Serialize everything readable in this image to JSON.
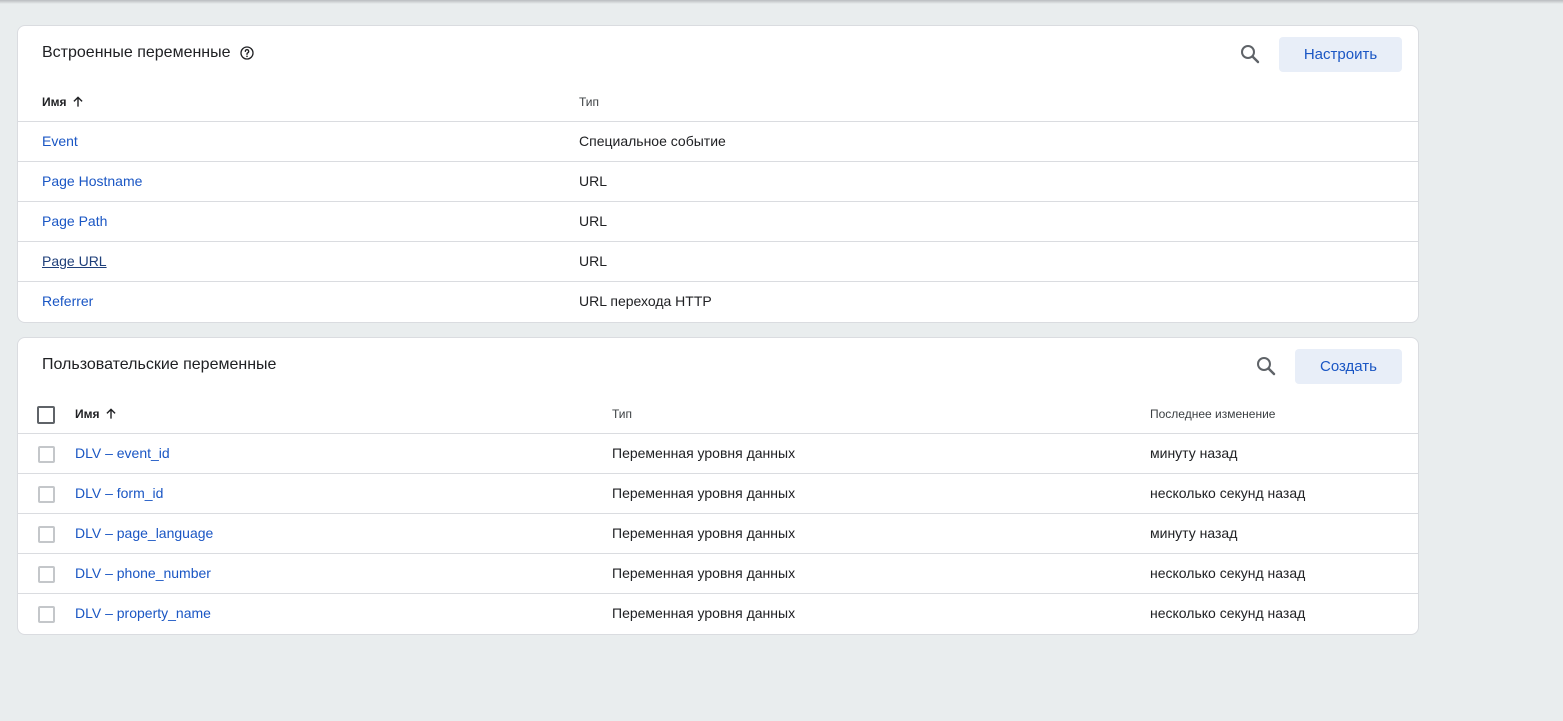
{
  "builtin": {
    "title": "Встроенные переменные",
    "configure_label": "Настроить",
    "columns": {
      "name": "Имя",
      "type": "Тип"
    },
    "rows": [
      {
        "name": "Event",
        "type": "Специальное событие"
      },
      {
        "name": "Page Hostname",
        "type": "URL"
      },
      {
        "name": "Page Path",
        "type": "URL"
      },
      {
        "name": "Page URL",
        "type": "URL"
      },
      {
        "name": "Referrer",
        "type": "URL перехода HTTP"
      }
    ]
  },
  "user": {
    "title": "Пользовательские переменные",
    "create_label": "Создать",
    "columns": {
      "name": "Имя",
      "type": "Тип",
      "modified": "Последнее изменение"
    },
    "rows": [
      {
        "name": "DLV – event_id",
        "type": "Переменная уровня данных",
        "modified": "минуту назад"
      },
      {
        "name": "DLV – form_id",
        "type": "Переменная уровня данных",
        "modified": "несколько секунд назад"
      },
      {
        "name": "DLV – page_language",
        "type": "Переменная уровня данных",
        "modified": "минуту назад"
      },
      {
        "name": "DLV – phone_number",
        "type": "Переменная уровня данных",
        "modified": "несколько секунд назад"
      },
      {
        "name": "DLV – property_name",
        "type": "Переменная уровня данных",
        "modified": "несколько секунд назад"
      }
    ]
  },
  "icons": {
    "help": "help-circle-icon",
    "search": "search-icon",
    "sort": "arrow-up-icon",
    "checkbox": "checkbox-icon"
  },
  "colors": {
    "link": "#1a56c4",
    "button_bg": "#e8eef8",
    "background": "#e9edee"
  }
}
